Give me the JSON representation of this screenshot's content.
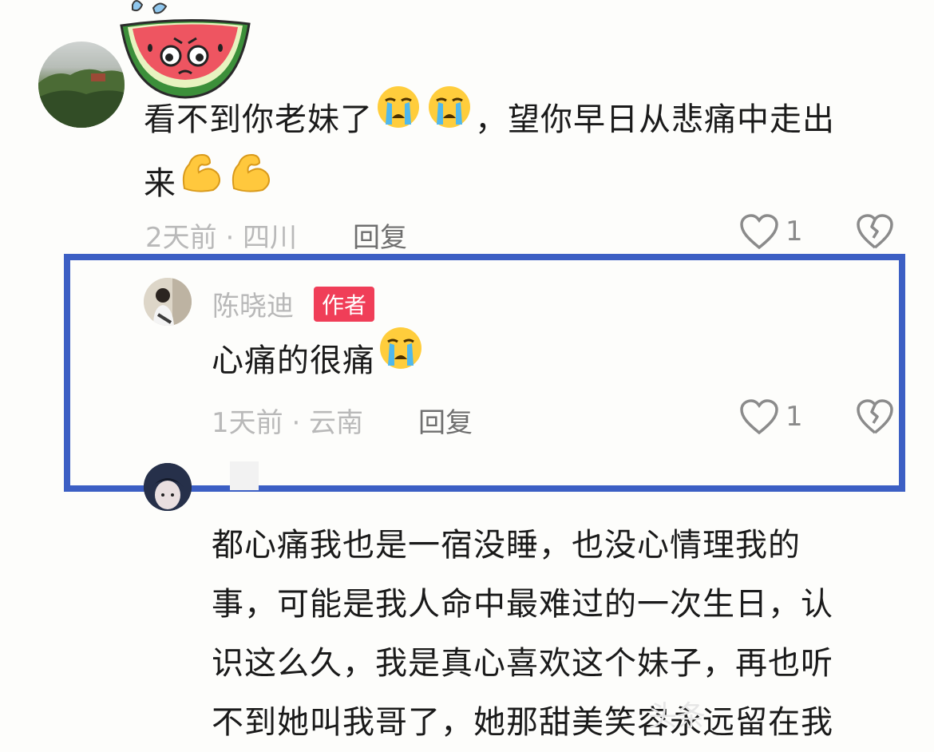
{
  "comment1": {
    "text_line1": "看不到你老妹了",
    "text_mid": "，望你早日从悲痛中走出",
    "text_line2": "来",
    "meta": "2天前 · 四川",
    "reply_label": "回复",
    "like_count": "1"
  },
  "comment2": {
    "username": "陈晓迪",
    "badge": "作者",
    "text": "心痛的很痛",
    "meta": "1天前 · 云南",
    "reply_label": "回复",
    "like_count": "1"
  },
  "comment3": {
    "lines": [
      "都心痛我也是一宿没睡，也没心情理我的",
      "事，可能是我人命中最难过的一次生日，认",
      "识这么久，我是真心喜欢这个妹子，再也听",
      "不到她叫我哥了，她那甜美笑容永远留在我"
    ]
  },
  "watermark": "头条",
  "colors": {
    "highlight": "#3c5fc4",
    "badge": "#f03e58",
    "meta": "#b9b9b9"
  },
  "icons": [
    "watermelon-sticker-icon",
    "crying-face-emoji-icon",
    "flexed-biceps-emoji-icon",
    "heart-outline-icon",
    "broken-heart-icon"
  ]
}
